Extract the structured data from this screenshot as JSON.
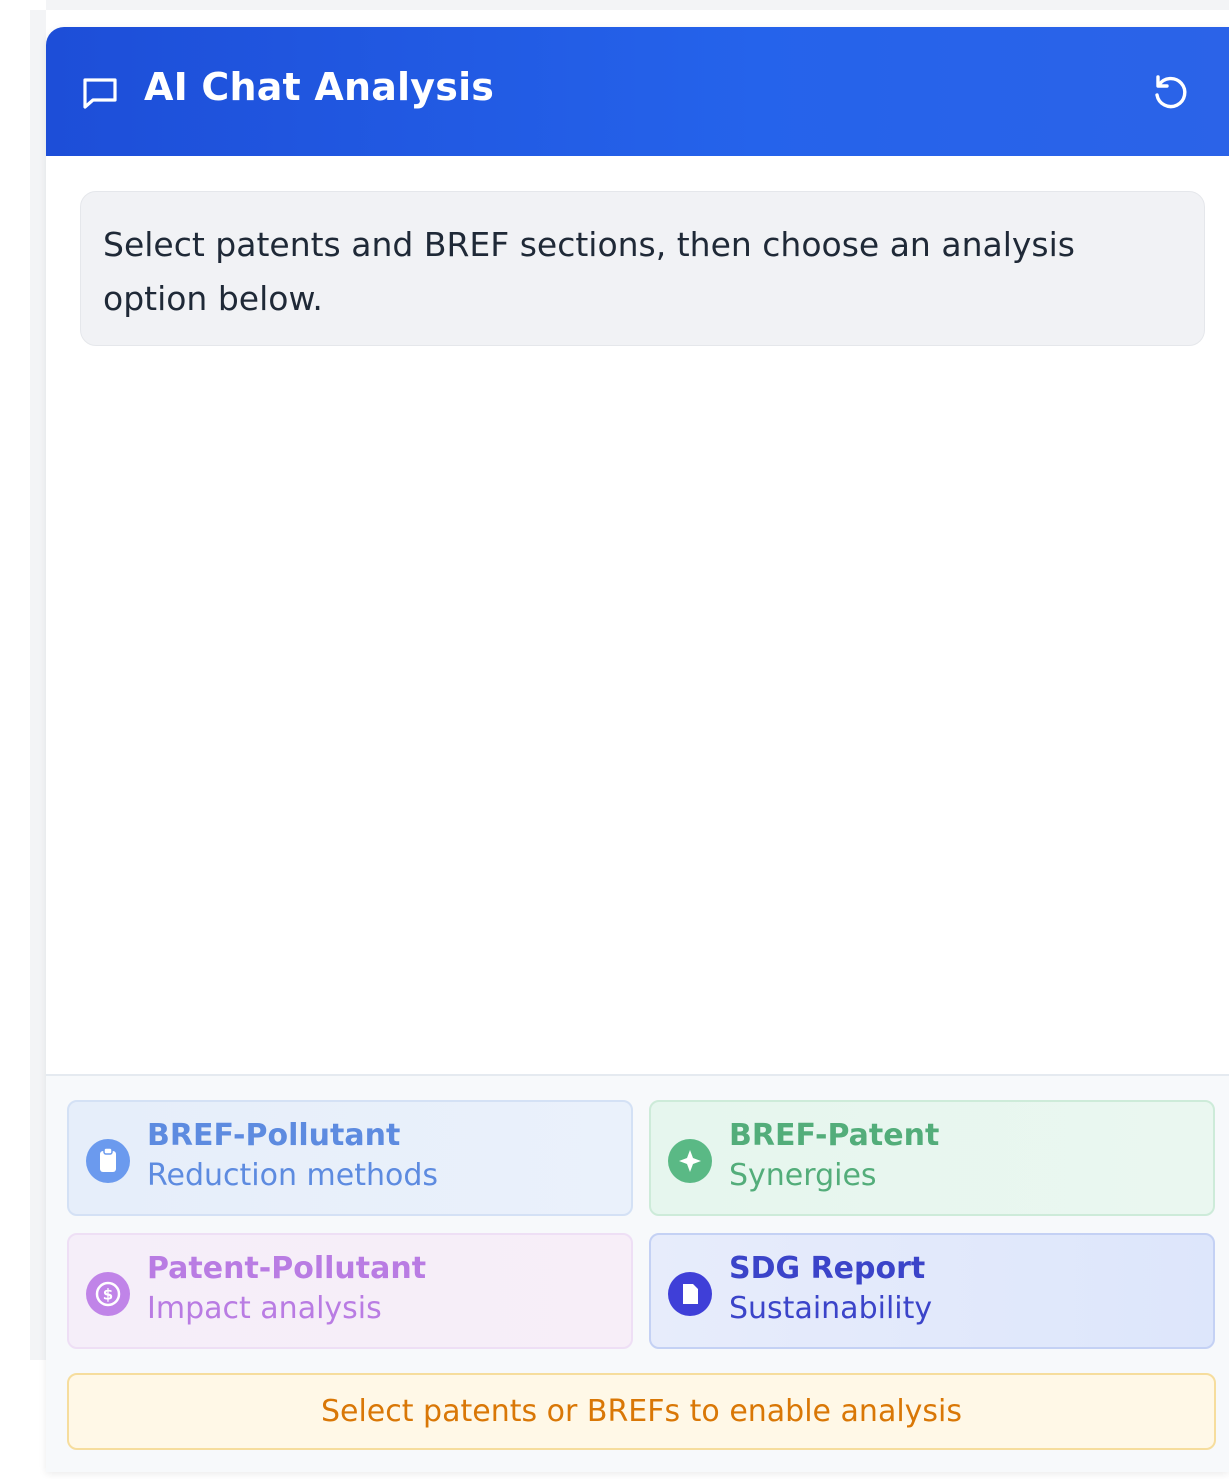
{
  "header": {
    "title": "AI Chat Analysis",
    "chat_icon": "chat-bubble-icon",
    "reset_icon": "rotate-ccw-icon",
    "background_color": "#1d4ed8"
  },
  "messages": [
    {
      "role": "assistant",
      "text": "Select patents and BREF sections, then choose an analysis option below."
    }
  ],
  "options": [
    {
      "title": "BREF-Pollutant",
      "subtitle": "Reduction methods",
      "icon": "clipboard-icon",
      "color": "#5d8be0"
    },
    {
      "title": "BREF-Patent",
      "subtitle": "Synergies",
      "icon": "sparkle-icon",
      "color": "#53ad7a"
    },
    {
      "title": "Patent-Pollutant",
      "subtitle": "Impact analysis",
      "icon": "dollar-icon",
      "color": "#b97ce3"
    },
    {
      "title": "SDG Report",
      "subtitle": "Sustainability",
      "icon": "document-icon",
      "color": "#3b44c9"
    }
  ],
  "notice": {
    "text": "Select patents or BREFs to enable analysis",
    "color": "#d97706"
  }
}
